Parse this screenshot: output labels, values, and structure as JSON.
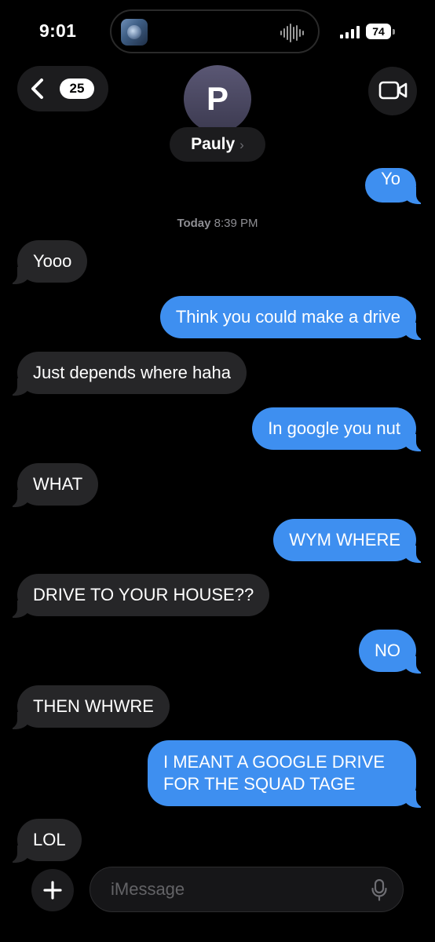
{
  "status_bar": {
    "time": "9:01",
    "battery": "74"
  },
  "header": {
    "back_count": "25",
    "avatar_initial": "P",
    "contact_name": "Pauly",
    "name_chevron": "›"
  },
  "conversation": {
    "timestamp_day": "Today",
    "timestamp_time": "8:39 PM",
    "messages": [
      {
        "from": "me",
        "text": "Yo"
      },
      {
        "from": "them",
        "text": "Yooo"
      },
      {
        "from": "me",
        "text": "Think you could make a drive"
      },
      {
        "from": "them",
        "text": "Just depends where haha"
      },
      {
        "from": "me",
        "text": "In google you nut"
      },
      {
        "from": "them",
        "text": "WHAT"
      },
      {
        "from": "me",
        "text": "WYM WHERE"
      },
      {
        "from": "them",
        "text": "DRIVE TO YOUR HOUSE??"
      },
      {
        "from": "me",
        "text": "NO"
      },
      {
        "from": "them",
        "text": "THEN WHWRE"
      },
      {
        "from": "me",
        "text": "I MEANT A GOOGLE DRIVE FOR THE SQUAD TAGE"
      },
      {
        "from": "them",
        "text": "LOL"
      }
    ]
  },
  "composer": {
    "placeholder": "iMessage"
  },
  "colors": {
    "outgoing_bubble": "#3e8ff0",
    "incoming_bubble": "#262628",
    "background": "#000000"
  },
  "icons": {
    "back": "chevron-left-icon",
    "video": "video-camera-icon",
    "add": "plus-icon",
    "mic": "microphone-icon",
    "signal": "cellular-signal-icon",
    "island_wave": "audio-waveform-icon"
  }
}
